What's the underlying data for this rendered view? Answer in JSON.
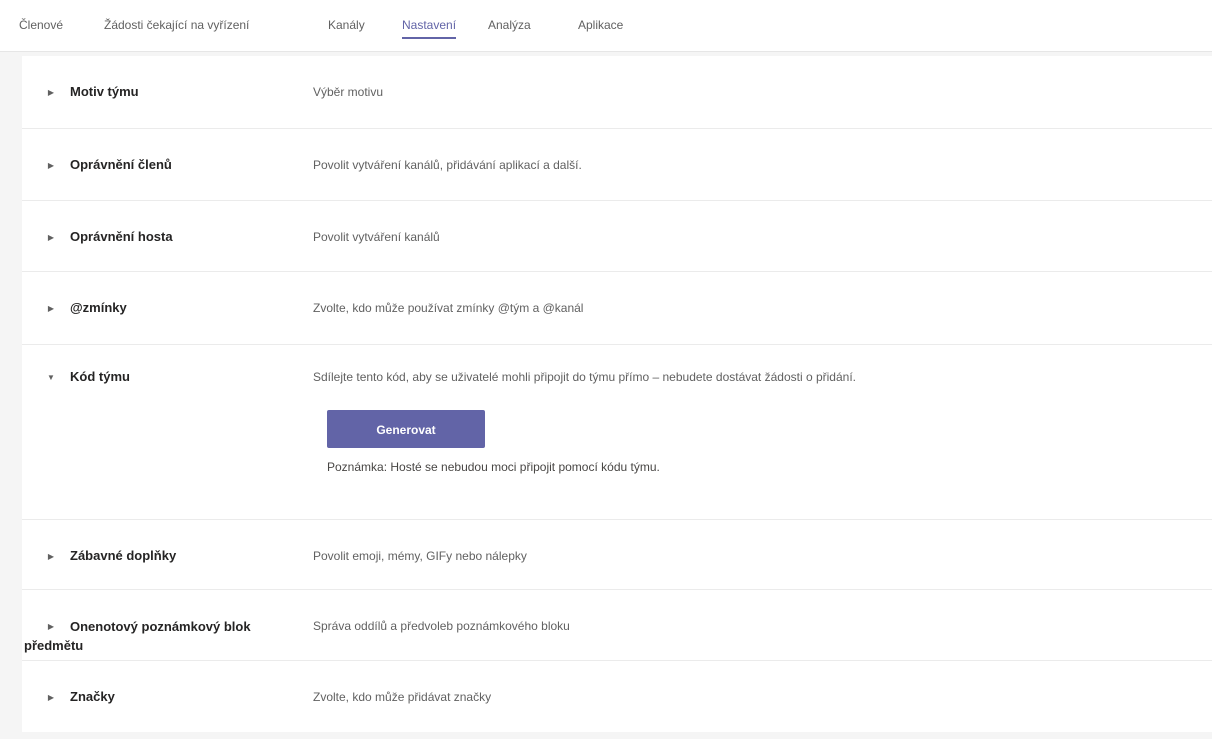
{
  "tabs": [
    {
      "label": "Členové"
    },
    {
      "label": "Žádosti čekající na vyřízení"
    },
    {
      "label": "Kanály"
    },
    {
      "label": "Nastavení"
    },
    {
      "label": "Analýza"
    },
    {
      "label": "Aplikace"
    }
  ],
  "active_tab": "Nastavení",
  "settings": [
    {
      "title": "Motiv týmu",
      "description": "Výběr motivu"
    },
    {
      "title": "Oprávnění členů",
      "description": "Povolit vytváření kanálů, přidávání aplikací a další."
    },
    {
      "title": "Oprávnění hosta",
      "description": "Povolit vytváření kanálů"
    },
    {
      "title": "@zmínky",
      "description": "Zvolte, kdo může používat zmínky @tým a @kanál"
    },
    {
      "title": "Kód týmu",
      "description": "Sdílejte tento kód, aby se uživatelé mohli připojit do týmu přímo – nebudete dostávat žádosti o přidání.",
      "button": "Generovat",
      "note": "Poznámka: Hosté se nebudou moci připojit pomocí kódu týmu."
    },
    {
      "title": "Zábavné doplňky",
      "description": "Povolit emoji, mémy, GIFy nebo nálepky"
    },
    {
      "title_line1": "Onenotový poznámkový blok",
      "title_line2": "předmětu",
      "description": "Správa oddílů a předvoleb poznámkového bloku"
    },
    {
      "title": "Značky",
      "description": "Zvolte, kdo může přidávat značky"
    }
  ],
  "colors": {
    "accent": "#6264a7",
    "background": "#f5f5f5",
    "panel": "#ffffff"
  },
  "icons": {
    "collapsed": "chevron-right-icon",
    "expanded": "chevron-down-icon"
  }
}
